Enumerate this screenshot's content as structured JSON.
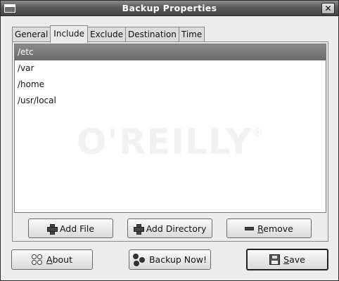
{
  "window": {
    "title": "Backup Properties",
    "close_glyph": "✕"
  },
  "tabs": [
    {
      "label": "General",
      "active": false
    },
    {
      "label": "Include",
      "active": true
    },
    {
      "label": "Exclude",
      "active": false
    },
    {
      "label": "Destination",
      "active": false
    },
    {
      "label": "Time",
      "active": false
    }
  ],
  "include_list": {
    "items": [
      "/etc",
      "/var",
      "/home",
      "/usr/local"
    ],
    "selected_index": 0
  },
  "watermark": {
    "text": "O'REILLY",
    "mark": "®"
  },
  "panel_buttons": {
    "add_file": "Add File",
    "add_directory": "Add Directory",
    "remove_mnemonic": "R",
    "remove_rest": "emove"
  },
  "footer_buttons": {
    "about_mnemonic": "A",
    "about_rest": "bout",
    "backup_now": "Backup Now!",
    "save_mnemonic": "S",
    "save_rest": "ave"
  },
  "icons": {
    "add_file": "plus-icon",
    "add_directory": "plus-icon",
    "remove": "minus-icon",
    "about": "about-icon",
    "backup_now": "backup-icon",
    "save": "floppy-disk-icon"
  }
}
